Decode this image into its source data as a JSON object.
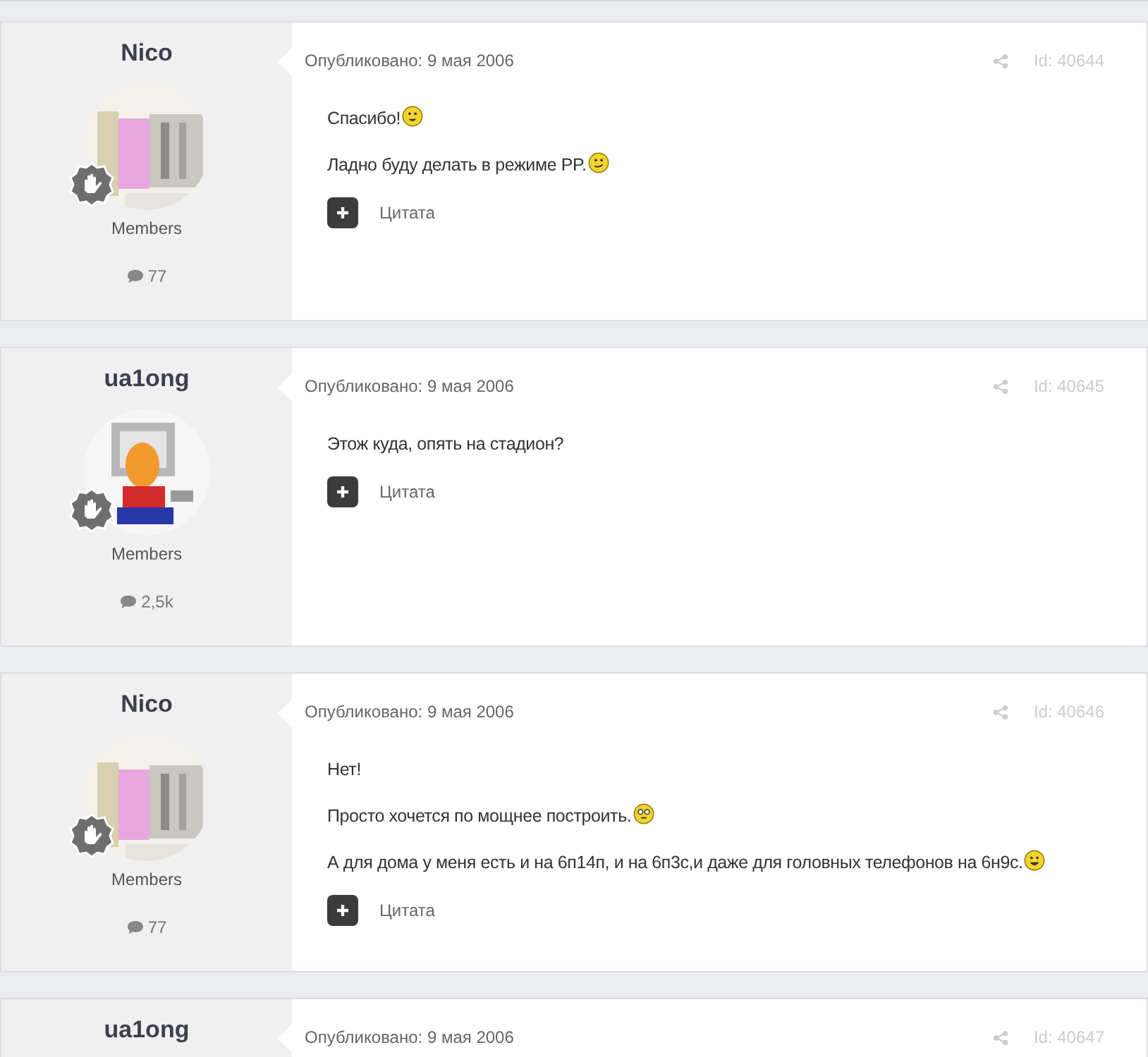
{
  "posts": [
    {
      "author": "Nico",
      "avatar": {
        "kind": "picture"
      },
      "rank": "Members",
      "posts_count": "77",
      "date": "Опубликовано: 9 мая 2006",
      "id": "Id: 40644",
      "paragraphs": [
        {
          "kind": "grin",
          "text": "Спасибо!"
        },
        {
          "kind": "smirk",
          "text": "Ладно буду делать в режиме PP."
        }
      ],
      "quote": "Цитата"
    },
    {
      "author": "ua1ong",
      "avatar": {
        "kind": "picture"
      },
      "rank": "Members",
      "posts_count": "2,5k",
      "date": "Опубликовано: 9 мая 2006",
      "id": "Id: 40645",
      "paragraphs": [
        {
          "kind": "plain",
          "text": "Этож куда, опять на стадион?"
        }
      ],
      "quote": "Цитата"
    },
    {
      "author": "Nico",
      "avatar": {
        "kind": "picture"
      },
      "rank": "Members",
      "posts_count": "77",
      "date": "Опубликовано: 9 мая 2006",
      "id": "Id: 40646",
      "paragraphs": [
        {
          "kind": "plain",
          "text": "Нет!"
        },
        {
          "kind": "glasses",
          "text": "Просто хочется по мощнее построить."
        },
        {
          "kind": "laugh",
          "text": "А для дома у меня есть и на 6п14п, и на 6п3с,и даже для головных телефонов на 6н9с."
        }
      ],
      "quote": "Цитата"
    },
    {
      "author": "ua1ong",
      "date": "Опубликовано: 9 мая 2006",
      "id": "Id: 40647"
    }
  ]
}
